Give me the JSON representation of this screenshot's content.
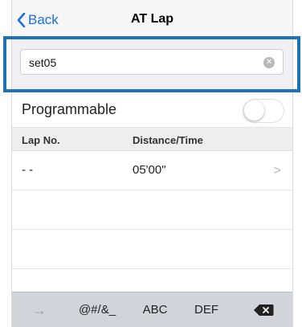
{
  "nav": {
    "back_label": "Back",
    "title": "AT Lap"
  },
  "name_field": {
    "value": "set05"
  },
  "programmable": {
    "label": "Programmable",
    "enabled": false
  },
  "table": {
    "headers": [
      "Lap No.",
      "Distance/Time"
    ],
    "rows": [
      {
        "lap": "- -",
        "value": "05'00\""
      }
    ]
  },
  "keyboard": {
    "keys": [
      "→",
      "@#/&_",
      "ABC",
      "DEF"
    ],
    "delete_icon": "backspace-icon"
  },
  "colors": {
    "accent": "#1b6fe0",
    "highlight_box": "#1e72b8"
  }
}
